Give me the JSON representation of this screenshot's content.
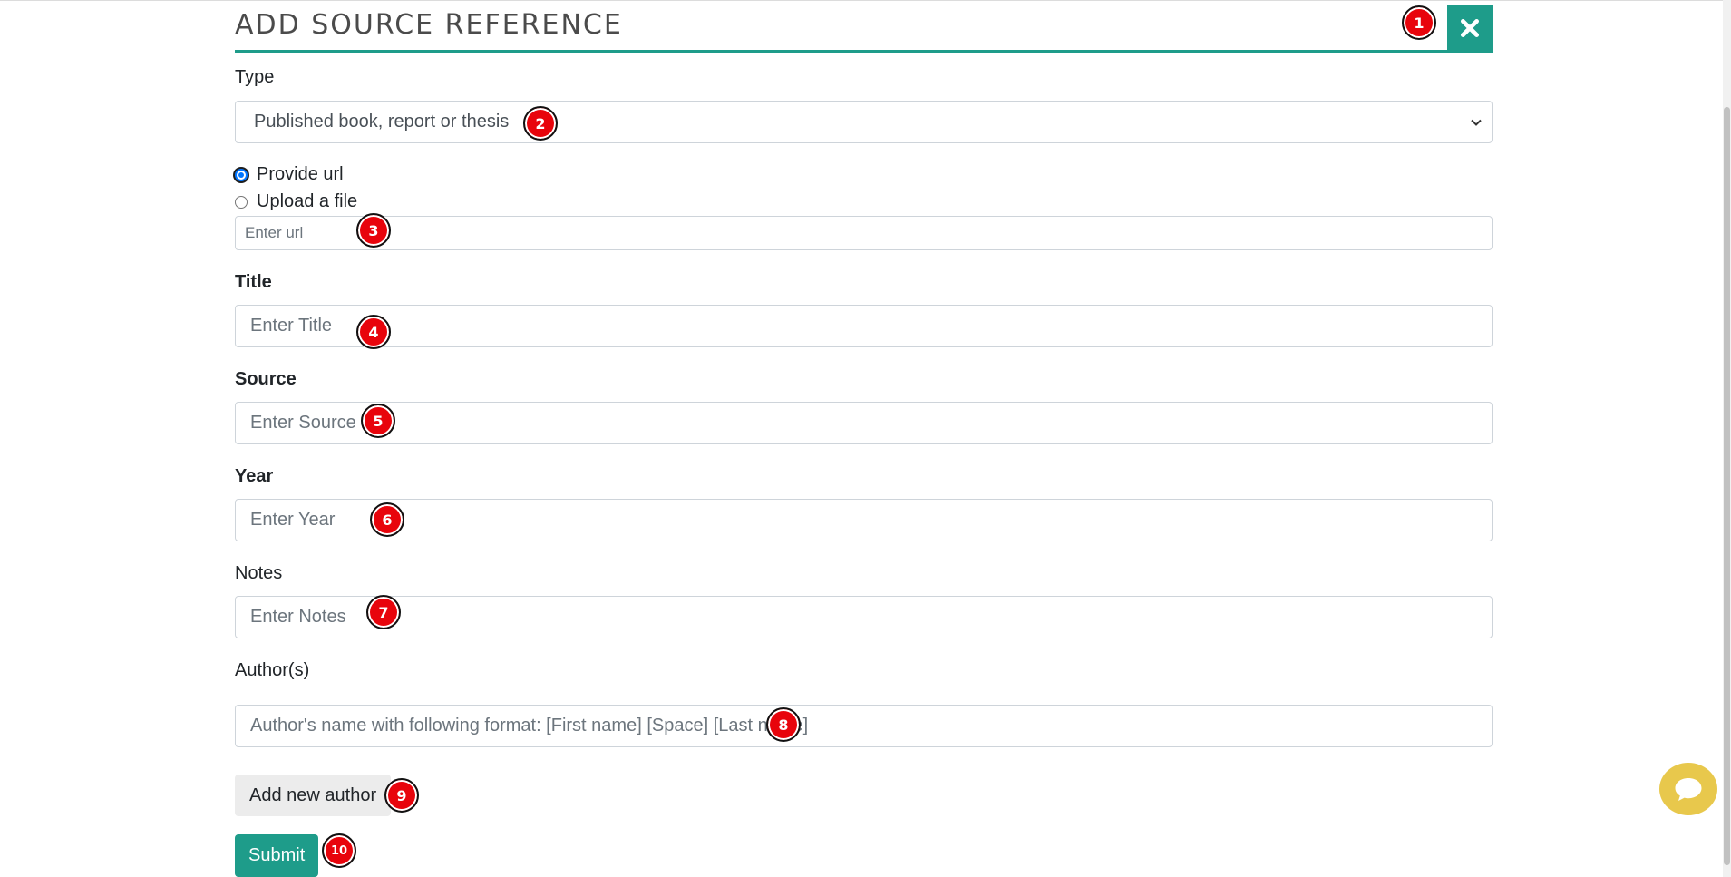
{
  "modal": {
    "title": "ADD SOURCE REFERENCE"
  },
  "form": {
    "type_label": "Type",
    "type_selected": "Published book, report or thesis",
    "radio_url_label": "Provide url",
    "radio_file_label": "Upload a file",
    "url_placeholder": "Enter url",
    "title_label": "Title",
    "title_placeholder": "Enter Title",
    "source_label": "Source",
    "source_placeholder": "Enter Source",
    "year_label": "Year",
    "year_placeholder": "Enter Year",
    "notes_label": "Notes",
    "notes_placeholder": "Enter Notes",
    "authors_label": "Author(s)",
    "author_placeholder": "Author's name with following format: [First name] [Space] [Last name]",
    "add_author_label": "Add new author",
    "submit_label": "Submit"
  },
  "badges": [
    "1",
    "2",
    "3",
    "4",
    "5",
    "6",
    "7",
    "8",
    "9",
    "10"
  ],
  "icons": {
    "close": "close-icon",
    "dropdown": "chevron-down-icon",
    "chat": "chat-bubble-icon"
  },
  "colors": {
    "accent": "#1e9c8a",
    "badge": "#e8040c",
    "chat": "#e8c84c"
  }
}
